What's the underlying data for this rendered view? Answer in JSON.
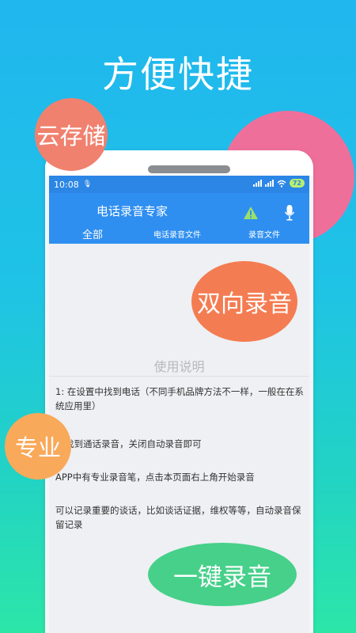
{
  "promo": {
    "headline": "方便快捷",
    "bubbles": {
      "cloud": "云存储",
      "two_way": "双向录音",
      "pro": "专业",
      "one_key": "一键录音"
    }
  },
  "status_bar": {
    "time": "10:08",
    "battery": "72"
  },
  "app_bar": {
    "title": "电话录音专家",
    "tabs": [
      "全部",
      "电话录音文件",
      "录音文件"
    ]
  },
  "instructions": {
    "title": "使用说明",
    "items": [
      "1: 在设置中找到电话（不同手机品牌方法不一样，一般在在系统应用里）",
      "找到通话录音，关闭自动录音即可",
      "APP中有专业录音笔，点击本页面右上角开始录音",
      "可以记录重要的谈话，比如谈话证据，维权等等，自动录音保留记录"
    ]
  }
}
